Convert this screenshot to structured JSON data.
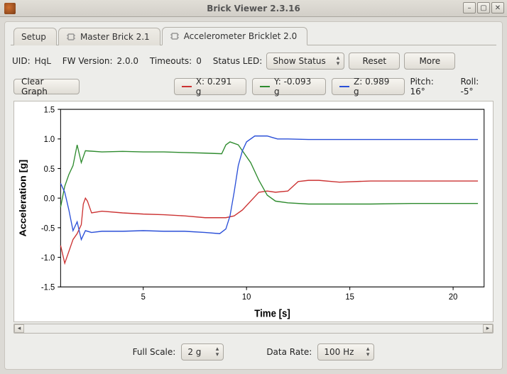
{
  "window": {
    "title": "Brick Viewer 2.3.16",
    "min_icon": "–",
    "max_icon": "▢",
    "close_icon": "✕"
  },
  "tabs": [
    {
      "label": "Setup"
    },
    {
      "label": "Master Brick 2.1"
    },
    {
      "label": "Accelerometer Bricklet 2.0"
    }
  ],
  "active_tab": 2,
  "info": {
    "uid_label": "UID:",
    "uid_value": "HqL",
    "fw_label": "FW Version:",
    "fw_value": "2.0.0",
    "timeouts_label": "Timeouts:",
    "timeouts_value": "0",
    "statusled_label": "Status LED:",
    "statusled_value": "Show Status"
  },
  "buttons": {
    "reset": "Reset",
    "more": "More",
    "clear_graph": "Clear Graph"
  },
  "legend": {
    "x": "X: 0.291 g",
    "y": "Y: -0.093 g",
    "z": "Z: 0.989 g"
  },
  "orientation": {
    "pitch": "Pitch: 16°",
    "roll": "Roll: -5°"
  },
  "footer": {
    "fullscale_label": "Full Scale:",
    "fullscale_value": "2 g",
    "datarate_label": "Data Rate:",
    "datarate_value": "100 Hz"
  },
  "colors": {
    "x": "#cc3333",
    "y": "#2e8b2e",
    "z": "#2a4fd8"
  },
  "chart_data": {
    "type": "line",
    "title": "",
    "xlabel": "Time [s]",
    "ylabel": "Acceleration [g]",
    "xlim": [
      1,
      21.5
    ],
    "ylim": [
      -1.5,
      1.5
    ],
    "yticks": [
      -1.5,
      -1.0,
      -0.5,
      0.0,
      0.5,
      1.0,
      1.5
    ],
    "xticks": [
      5,
      10,
      15,
      20
    ],
    "series": [
      {
        "name": "X",
        "color": "#cc3333",
        "values": [
          [
            1.0,
            -0.8
          ],
          [
            1.2,
            -1.1
          ],
          [
            1.4,
            -0.9
          ],
          [
            1.6,
            -0.7
          ],
          [
            1.8,
            -0.6
          ],
          [
            2.0,
            -0.45
          ],
          [
            2.1,
            -0.1
          ],
          [
            2.2,
            0.0
          ],
          [
            2.3,
            -0.05
          ],
          [
            2.5,
            -0.25
          ],
          [
            3.0,
            -0.22
          ],
          [
            4.0,
            -0.25
          ],
          [
            5.0,
            -0.27
          ],
          [
            6.0,
            -0.28
          ],
          [
            7.0,
            -0.3
          ],
          [
            8.0,
            -0.33
          ],
          [
            8.8,
            -0.33
          ],
          [
            9.0,
            -0.33
          ],
          [
            9.4,
            -0.3
          ],
          [
            9.8,
            -0.2
          ],
          [
            10.2,
            -0.05
          ],
          [
            10.6,
            0.1
          ],
          [
            11.0,
            0.12
          ],
          [
            11.4,
            0.1
          ],
          [
            12.0,
            0.12
          ],
          [
            12.5,
            0.28
          ],
          [
            13.0,
            0.3
          ],
          [
            13.5,
            0.3
          ],
          [
            14.5,
            0.27
          ],
          [
            16.0,
            0.29
          ],
          [
            18.0,
            0.29
          ],
          [
            20.0,
            0.29
          ],
          [
            21.2,
            0.29
          ]
        ]
      },
      {
        "name": "Y",
        "color": "#2e8b2e",
        "values": [
          [
            1.0,
            -0.15
          ],
          [
            1.2,
            0.2
          ],
          [
            1.4,
            0.4
          ],
          [
            1.6,
            0.55
          ],
          [
            1.8,
            0.9
          ],
          [
            2.0,
            0.6
          ],
          [
            2.2,
            0.8
          ],
          [
            3.0,
            0.78
          ],
          [
            4.0,
            0.79
          ],
          [
            5.0,
            0.78
          ],
          [
            6.0,
            0.78
          ],
          [
            7.0,
            0.77
          ],
          [
            8.0,
            0.76
          ],
          [
            8.8,
            0.75
          ],
          [
            9.0,
            0.9
          ],
          [
            9.2,
            0.95
          ],
          [
            9.6,
            0.9
          ],
          [
            10.2,
            0.6
          ],
          [
            10.6,
            0.3
          ],
          [
            11.0,
            0.05
          ],
          [
            11.4,
            -0.05
          ],
          [
            12.0,
            -0.08
          ],
          [
            13.0,
            -0.1
          ],
          [
            14.0,
            -0.1
          ],
          [
            16.0,
            -0.1
          ],
          [
            18.0,
            -0.09
          ],
          [
            20.0,
            -0.09
          ],
          [
            21.2,
            -0.09
          ]
        ]
      },
      {
        "name": "Z",
        "color": "#2a4fd8",
        "values": [
          [
            1.0,
            0.25
          ],
          [
            1.2,
            0.1
          ],
          [
            1.4,
            -0.2
          ],
          [
            1.6,
            -0.55
          ],
          [
            1.8,
            -0.4
          ],
          [
            2.0,
            -0.7
          ],
          [
            2.2,
            -0.55
          ],
          [
            2.5,
            -0.58
          ],
          [
            3.0,
            -0.56
          ],
          [
            4.0,
            -0.56
          ],
          [
            5.0,
            -0.55
          ],
          [
            6.0,
            -0.56
          ],
          [
            7.0,
            -0.56
          ],
          [
            8.0,
            -0.58
          ],
          [
            8.7,
            -0.6
          ],
          [
            9.0,
            -0.52
          ],
          [
            9.2,
            -0.3
          ],
          [
            9.4,
            0.1
          ],
          [
            9.6,
            0.55
          ],
          [
            9.8,
            0.8
          ],
          [
            10.0,
            0.95
          ],
          [
            10.4,
            1.05
          ],
          [
            11.0,
            1.05
          ],
          [
            11.5,
            1.0
          ],
          [
            12.0,
            1.0
          ],
          [
            13.0,
            0.99
          ],
          [
            14.0,
            0.99
          ],
          [
            16.0,
            0.99
          ],
          [
            18.0,
            0.99
          ],
          [
            20.0,
            0.99
          ],
          [
            21.2,
            0.99
          ]
        ]
      }
    ]
  }
}
